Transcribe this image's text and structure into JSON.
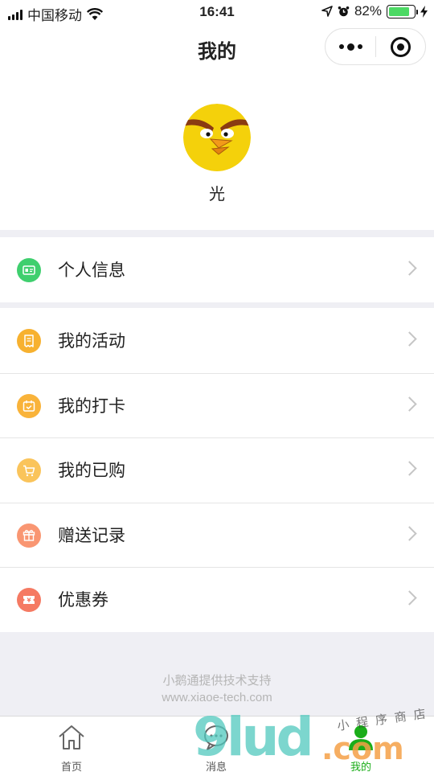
{
  "status_bar": {
    "carrier": "中国移动",
    "time": "16:41",
    "battery": "82%",
    "battery_level": 0.82
  },
  "nav": {
    "title": "我的"
  },
  "profile": {
    "name": "光",
    "avatar_icon": "angry-yellow-bird-avatar"
  },
  "menu": {
    "personal": {
      "label": "个人信息",
      "icon": "id-card-icon",
      "color": "#3fcf6e"
    },
    "items": [
      {
        "label": "我的活动",
        "icon": "receipt-icon",
        "color": "#f7b12f"
      },
      {
        "label": "我的打卡",
        "icon": "calendar-check-icon",
        "color": "#f9b33a"
      },
      {
        "label": "我的已购",
        "icon": "cart-icon",
        "color": "#fac45b"
      },
      {
        "label": "赠送记录",
        "icon": "gift-icon",
        "color": "#f99672"
      },
      {
        "label": "优惠券",
        "icon": "coupon-icon",
        "color": "#f57a63"
      }
    ]
  },
  "footer": {
    "line1": "小鹅通提供技术支持",
    "line2": "www.xiaoe-tech.com"
  },
  "tabbar": {
    "tabs": [
      {
        "label": "首页",
        "icon": "home-icon"
      },
      {
        "label": "消息",
        "icon": "chat-icon"
      },
      {
        "label": "我的",
        "icon": "person-icon",
        "active": true
      }
    ]
  },
  "watermark": {
    "text_big": "9lud",
    "text_com": ".com",
    "text_small": "小程序商店"
  }
}
